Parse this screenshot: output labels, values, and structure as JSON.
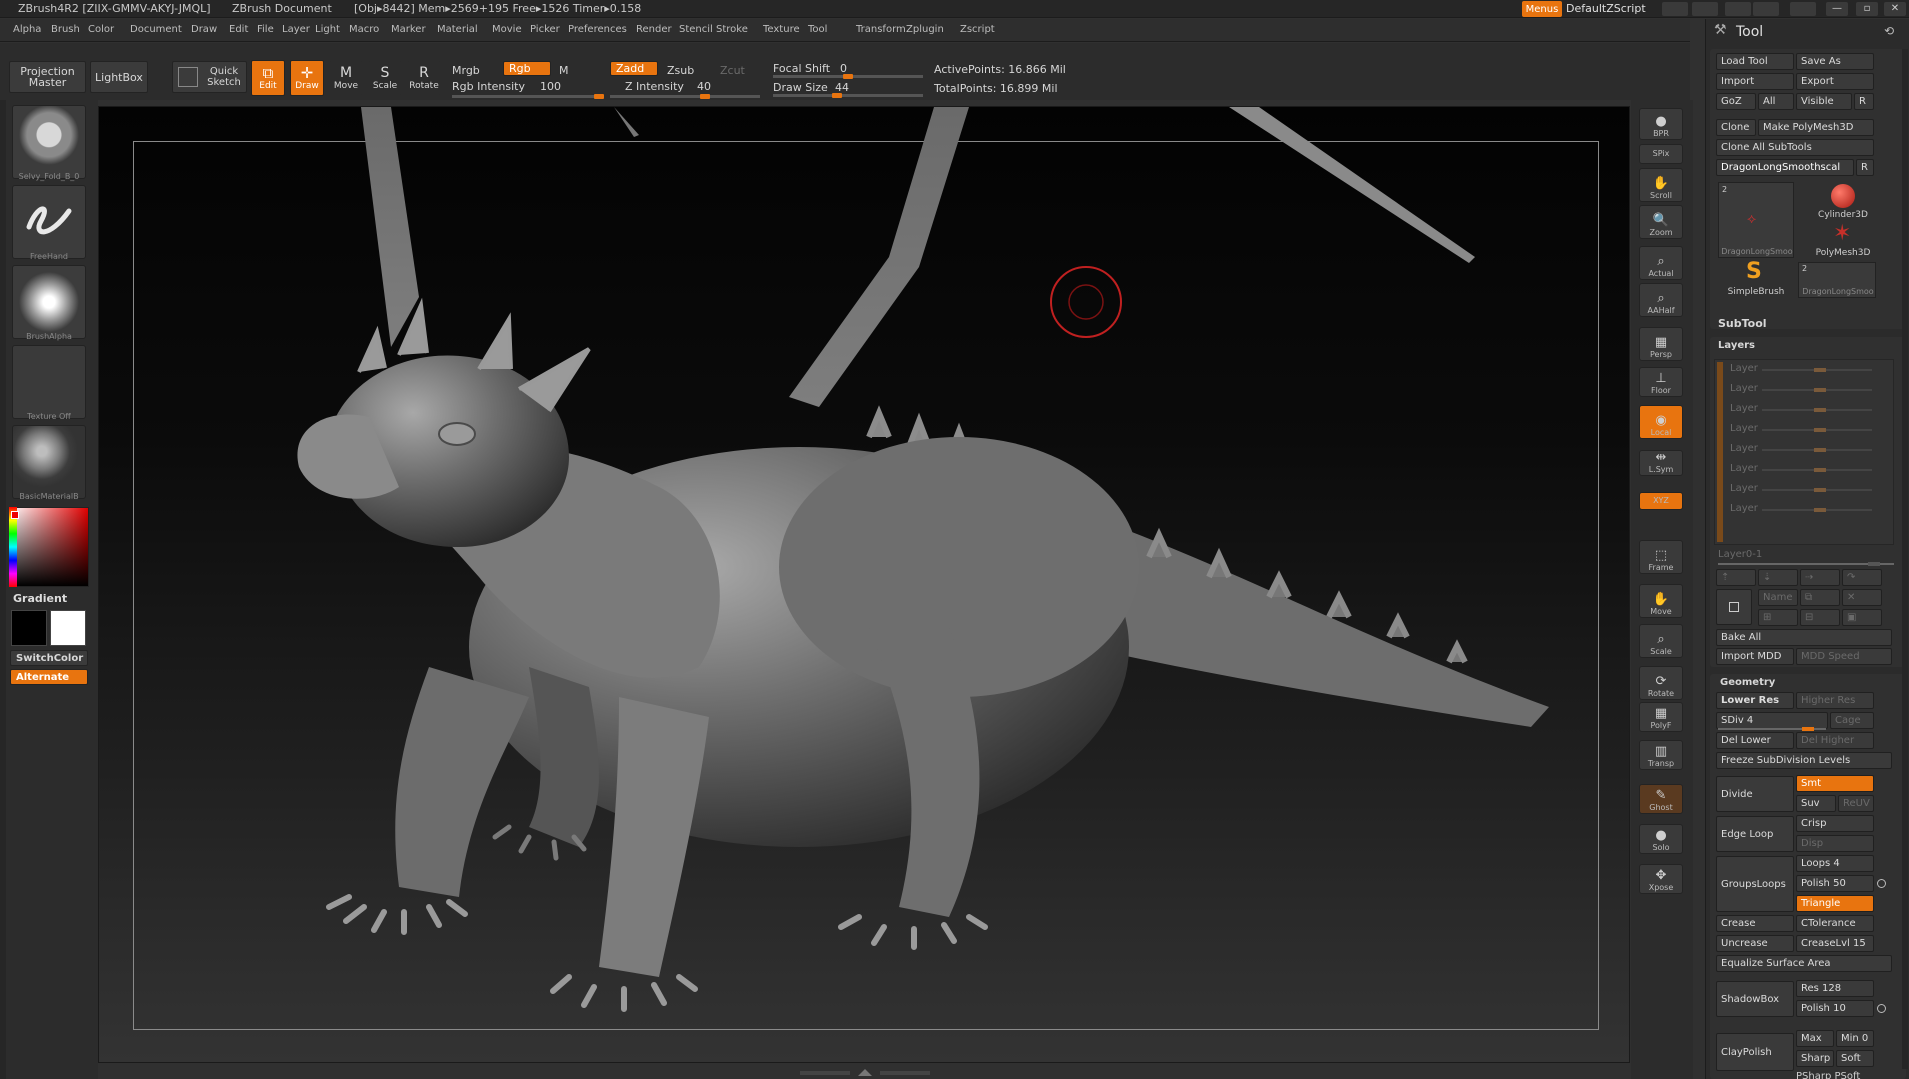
{
  "titlebar": {
    "app": "ZBrush4R2 [ZIIX-GMMV-AKYJ-JMQL]",
    "document": "ZBrush Document",
    "stats": "[Obj▸8442] Mem▸2569+195 Free▸1526 Timer▸0.158",
    "menus_label": "Menus",
    "script_label": "DefaultZScript"
  },
  "menus": [
    "Alpha",
    "Brush",
    "Color",
    "Document",
    "Draw",
    "Edit",
    "File",
    "Layer",
    "Light",
    "Macro",
    "Marker",
    "Material",
    "Movie",
    "Picker",
    "Preferences",
    "Render",
    "Stencil",
    "Stroke",
    "Texture",
    "Tool",
    "Transform",
    "Zplugin",
    "Zscript"
  ],
  "toolbar": {
    "projection_master": "Projection Master",
    "lightbox": "LightBox",
    "quick_sketch": "Quick Sketch",
    "edit": "Edit",
    "draw": "Draw",
    "move": "Move",
    "scale": "Scale",
    "rotate": "Rotate",
    "mrgb": "Mrgb",
    "rgb": "Rgb",
    "m": "M",
    "zadd": "Zadd",
    "zsub": "Zsub",
    "zcut": "Zcut",
    "rgb_intensity_label": "Rgb Intensity",
    "rgb_intensity": "100",
    "z_intensity_label": "Z Intensity",
    "z_intensity": "40",
    "focal_shift_label": "Focal Shift",
    "focal_shift": "0",
    "draw_size_label": "Draw Size",
    "draw_size": "44",
    "active_points": "ActivePoints: 16.866 Mil",
    "total_points": "TotalPoints: 16.899 Mil"
  },
  "leftshelf": {
    "brush_label": "Selvy_Fold_B_0",
    "stroke_label": "FreeHand",
    "alpha_label": "BrushAlpha",
    "texture_label": "Texture Off",
    "material_label": "BasicMaterialB",
    "gradient_label": "Gradient",
    "switchcolor_label": "SwitchColor",
    "alternate_label": "Alternate"
  },
  "rightshelf": [
    {
      "name": "bpr",
      "label": "BPR"
    },
    {
      "name": "spix",
      "label": "SPix"
    },
    {
      "name": "scroll",
      "label": "Scroll"
    },
    {
      "name": "zoom",
      "label": "Zoom"
    },
    {
      "name": "actual",
      "label": "Actual"
    },
    {
      "name": "aahalf",
      "label": "AAHalf"
    },
    {
      "name": "persp",
      "label": "Persp"
    },
    {
      "name": "floor",
      "label": "Floor"
    },
    {
      "name": "local",
      "label": "Local"
    },
    {
      "name": "lsym",
      "label": "L.Sym"
    },
    {
      "name": "xyz",
      "label": "XYZ"
    },
    {
      "name": "frame",
      "label": "Frame"
    },
    {
      "name": "move",
      "label": "Move"
    },
    {
      "name": "scale",
      "label": "Scale"
    },
    {
      "name": "rotate",
      "label": "Rotate"
    },
    {
      "name": "polyf",
      "label": "PolyF"
    },
    {
      "name": "transp",
      "label": "Transp"
    },
    {
      "name": "ghost",
      "label": "Ghost"
    },
    {
      "name": "solo",
      "label": "Solo"
    },
    {
      "name": "xpose",
      "label": "Xpose"
    }
  ],
  "tool": {
    "title": "Tool",
    "load_tool": "Load Tool",
    "save_as": "Save As",
    "import": "Import",
    "export": "Export",
    "goz": "GoZ",
    "all": "All",
    "visible": "Visible",
    "r": "R",
    "clone": "Clone",
    "make_polymesh": "Make PolyMesh3D",
    "clone_all": "Clone All SubTools",
    "current_tool": "DragonLongSmoothscal",
    "thumb1_count": "2",
    "thumb1_label": "DragonLongSmoo",
    "cylinder": "Cylinder3D",
    "polymesh": "PolyMesh3D",
    "simplebrush": "SimpleBrush",
    "thumb4_count": "2",
    "thumb4_label": "DragonLongSmoo",
    "subtool": "SubTool",
    "layers": "Layers",
    "layer_item": "Layer",
    "layer_name": "Layer0-1",
    "name_btn": "Name",
    "bake_all": "Bake All",
    "import_mdd": "Import MDD",
    "mdd_speed": "MDD Speed",
    "geometry": "Geometry",
    "lower_res": "Lower Res",
    "higher_res": "Higher Res",
    "sdiv": "SDiv 4",
    "cage": "Cage",
    "del_lower": "Del Lower",
    "del_higher": "Del Higher",
    "freeze": "Freeze SubDivision Levels",
    "divide": "Divide",
    "smt": "Smt",
    "suv": "Suv",
    "reuv": "ReUV",
    "edge_loop": "Edge Loop",
    "crisp": "Crisp",
    "disp": "Disp",
    "groupsloops": "GroupsLoops",
    "loops": "Loops 4",
    "polish": "Polish 50",
    "triangle": "Triangle",
    "crease": "Crease",
    "ctolerance": "CTolerance",
    "uncrease": "Uncrease",
    "creaselvl": "CreaseLvl 15",
    "equalize": "Equalize Surface Area",
    "shadowbox": "ShadowBox",
    "res": "Res 128",
    "polish10": "Polish 10",
    "claypolish": "ClayPolish",
    "max": "Max",
    "min": "Min 0",
    "sharp": "Sharp",
    "soft": "Soft",
    "bottom_cut": "PSharp PSoft"
  },
  "colors": {
    "accent": "#e8740f",
    "panel": "#2b2b2b",
    "canvas_top": "#030303",
    "canvas_bottom": "#333333"
  }
}
